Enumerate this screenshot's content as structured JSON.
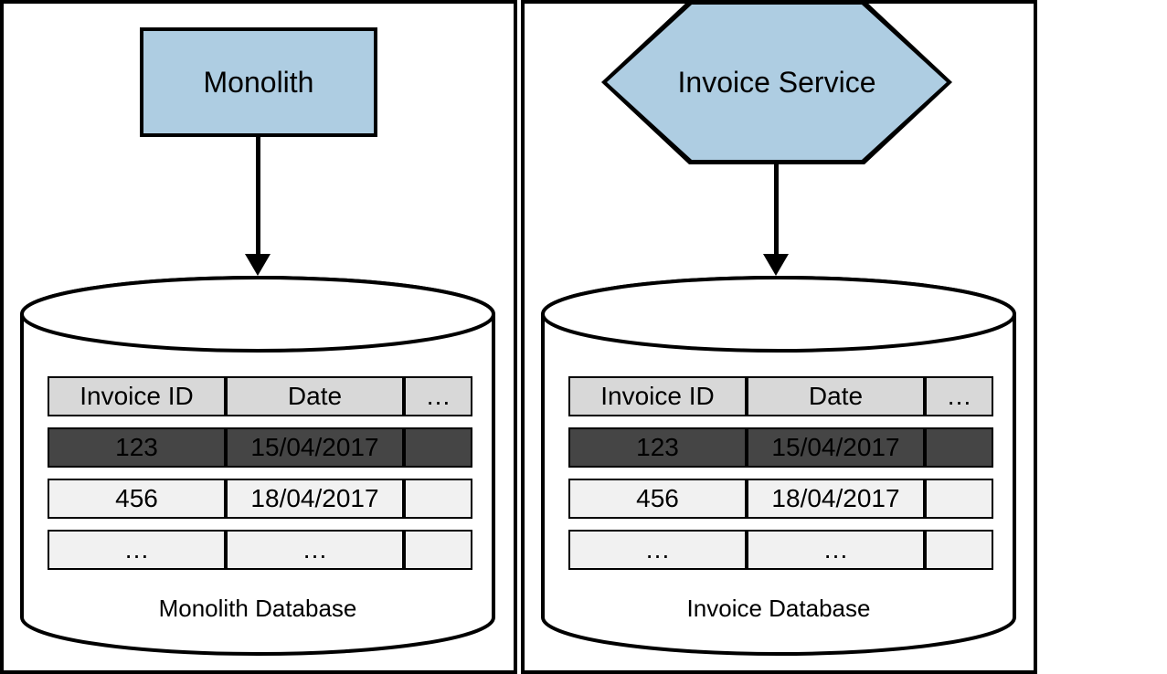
{
  "left": {
    "service_label": "Monolith",
    "db_label": "Monolith Database",
    "table": {
      "headers": {
        "id": "Invoice ID",
        "date": "Date",
        "more": "…"
      },
      "rows": [
        {
          "id": "123",
          "date": "15/04/2017",
          "more": ""
        },
        {
          "id": "456",
          "date": "18/04/2017",
          "more": ""
        },
        {
          "id": "…",
          "date": "…",
          "more": ""
        }
      ]
    }
  },
  "right": {
    "service_label": "Invoice Service",
    "db_label": "Invoice Database",
    "table": {
      "headers": {
        "id": "Invoice ID",
        "date": "Date",
        "more": "…"
      },
      "rows": [
        {
          "id": "123",
          "date": "15/04/2017",
          "more": ""
        },
        {
          "id": "456",
          "date": "18/04/2017",
          "more": ""
        },
        {
          "id": "…",
          "date": "…",
          "more": ""
        }
      ]
    }
  },
  "colors": {
    "node_fill": "#aecde2"
  }
}
